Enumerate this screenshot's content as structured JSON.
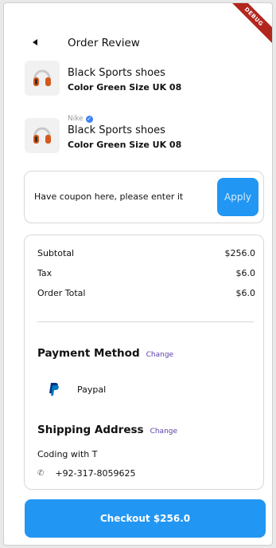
{
  "debug_banner": "DEBUG",
  "header": {
    "title": "Order Review"
  },
  "products": [
    {
      "brand": "",
      "title": "Black Sports shoes",
      "variant": "Color Green Size UK 08",
      "image_icon": "headphones-icon"
    },
    {
      "brand": "Nike",
      "title": "Black Sports shoes",
      "variant": "Color Green Size UK 08",
      "image_icon": "headphones-icon",
      "verified": true
    }
  ],
  "coupon": {
    "placeholder": "Have coupon here, please enter it",
    "apply_label": "Apply"
  },
  "summary": {
    "subtotal_label": "Subtotal",
    "subtotal_value": "$256.0",
    "tax_label": "Tax",
    "tax_value": "$6.0",
    "total_label": "Order Total",
    "total_value": "$6.0"
  },
  "payment": {
    "title": "Payment Method",
    "change_label": "Change",
    "method": "Paypal"
  },
  "shipping": {
    "title": "Shipping Address",
    "change_label": "Change",
    "name": "Coding with T",
    "phone": "+92-317-8059625"
  },
  "checkout": {
    "label": "Checkout $256.0"
  },
  "colors": {
    "accent": "#2196f3",
    "link": "#5b3fa8",
    "ribbon": "#b3261e"
  }
}
